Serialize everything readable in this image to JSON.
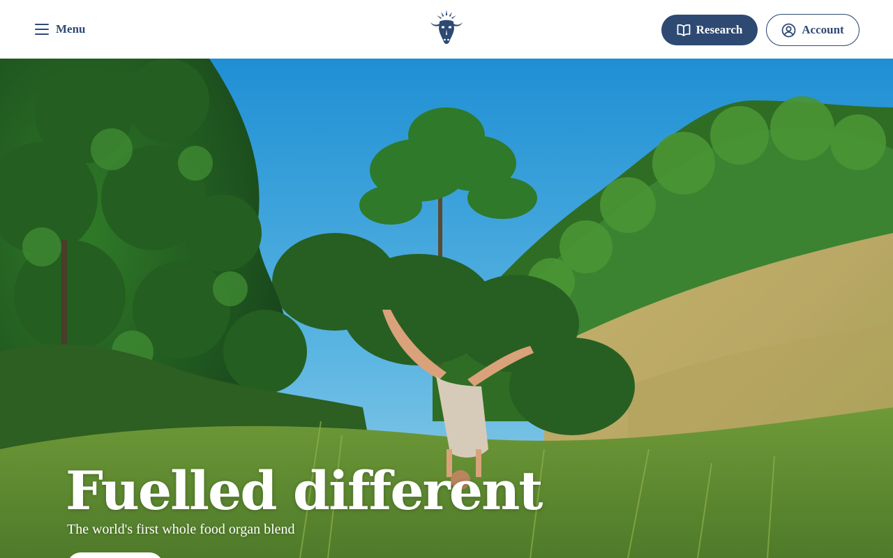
{
  "header": {
    "menu_label": "Menu",
    "menu_icon": "hamburger-icon",
    "logo_icon": "bull-head-logo-icon",
    "research_label": "Research",
    "research_icon": "open-book-icon",
    "account_label": "Account",
    "account_icon": "user-circle-icon"
  },
  "hero": {
    "title": "Fuelled different",
    "subtitle": "The world's first whole food organ blend"
  },
  "colors": {
    "brand_navy": "#2e4a73",
    "header_bg": "#ffffff",
    "hero_text": "#ffffff"
  }
}
